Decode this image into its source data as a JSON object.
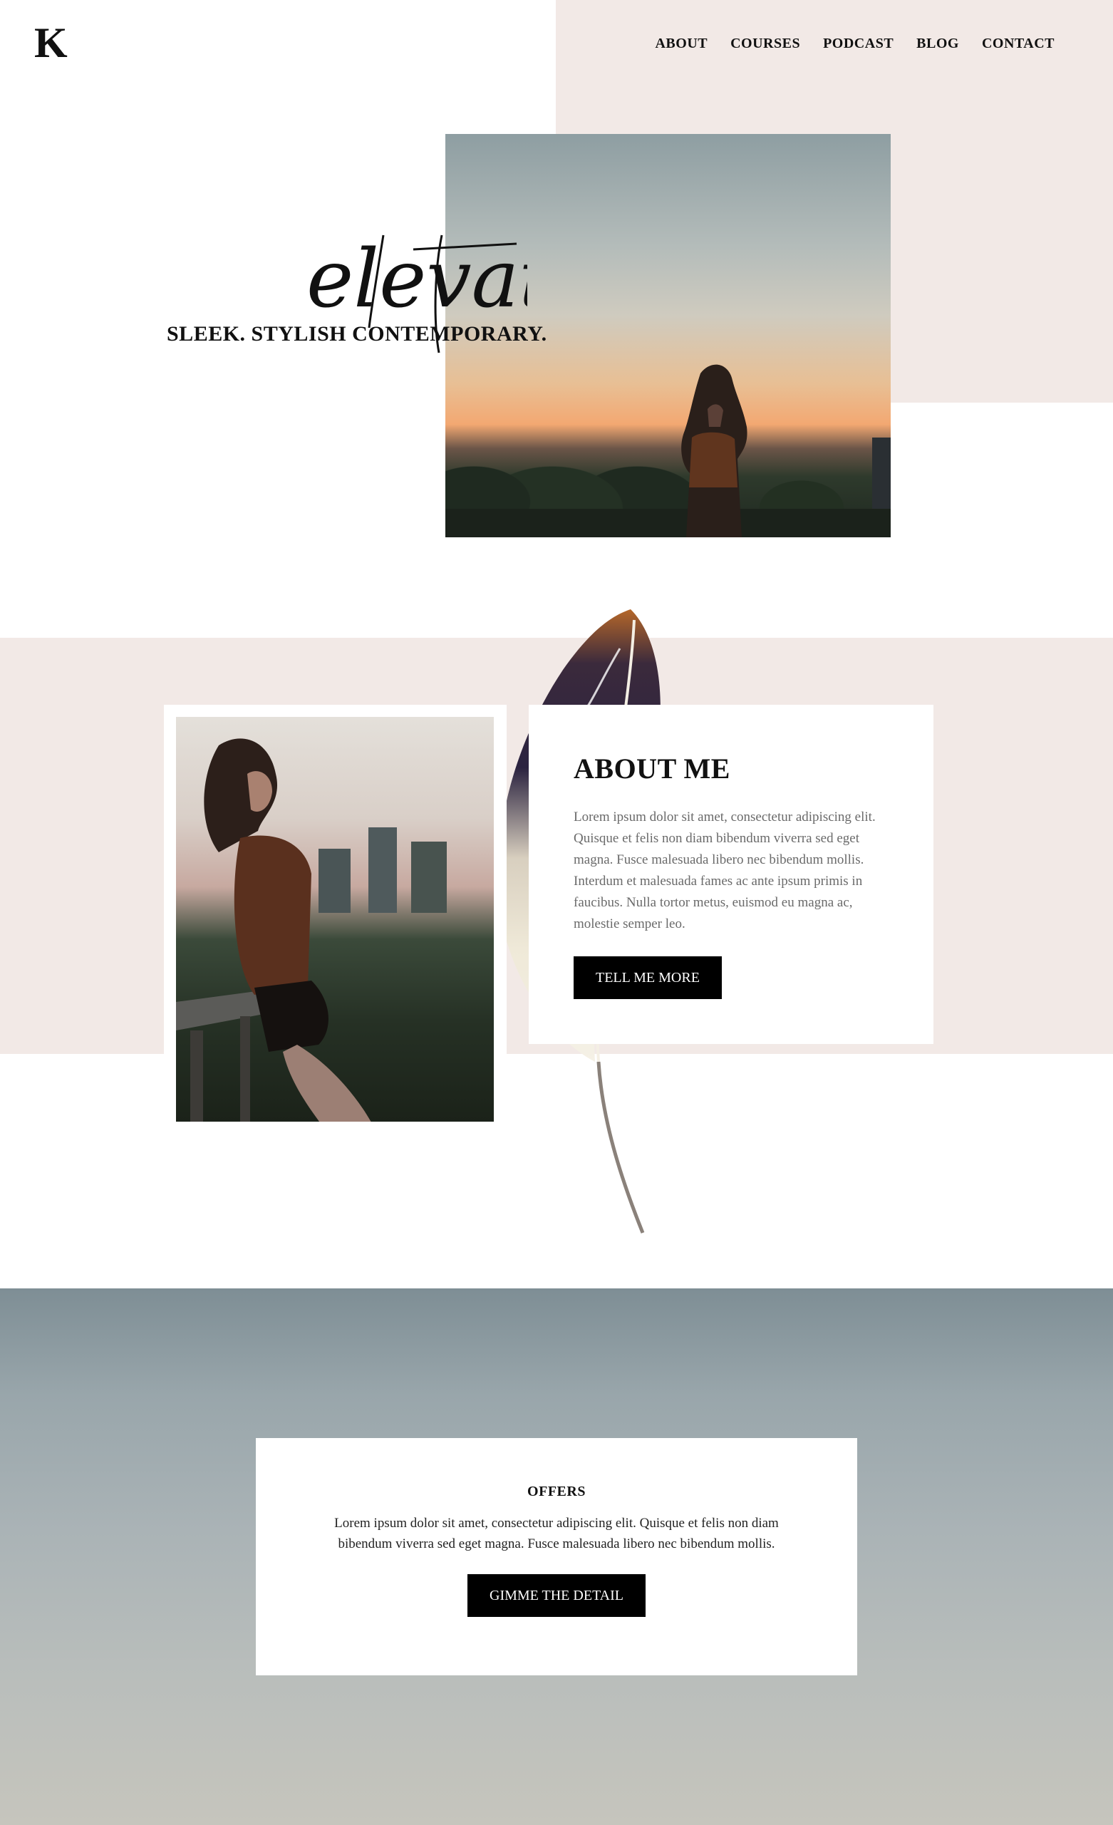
{
  "header": {
    "logo": "K",
    "nav": [
      "ABOUT",
      "COURSES",
      "PODCAST",
      "BLOG",
      "CONTACT"
    ]
  },
  "hero": {
    "script_word": "elevate",
    "tagline": "SLEEK. STYLISH CONTEMPORARY."
  },
  "about": {
    "title": "ABOUT ME",
    "body": "Lorem ipsum dolor sit amet, consectetur adipiscing elit. Quisque et felis non diam bibendum viverra sed eget magna. Fusce malesuada libero nec bibendum mollis. Interdum et malesuada fames ac ante ipsum primis in faucibus. Nulla tortor metus, euismod eu magna ac, molestie semper leo.",
    "button": "TELL ME MORE"
  },
  "offers": {
    "title": "OFFERS",
    "body": "Lorem ipsum dolor sit amet, consectetur adipiscing elit. Quisque et felis non diam bibendum viverra sed eget magna. Fusce malesuada libero nec bibendum mollis.",
    "button": "GIMME THE DETAIL"
  },
  "colors": {
    "blush": "#f2e9e6",
    "button_bg": "#000000",
    "text": "#111111"
  },
  "icons": [
    "feather-illustration",
    "script-wordmark"
  ]
}
